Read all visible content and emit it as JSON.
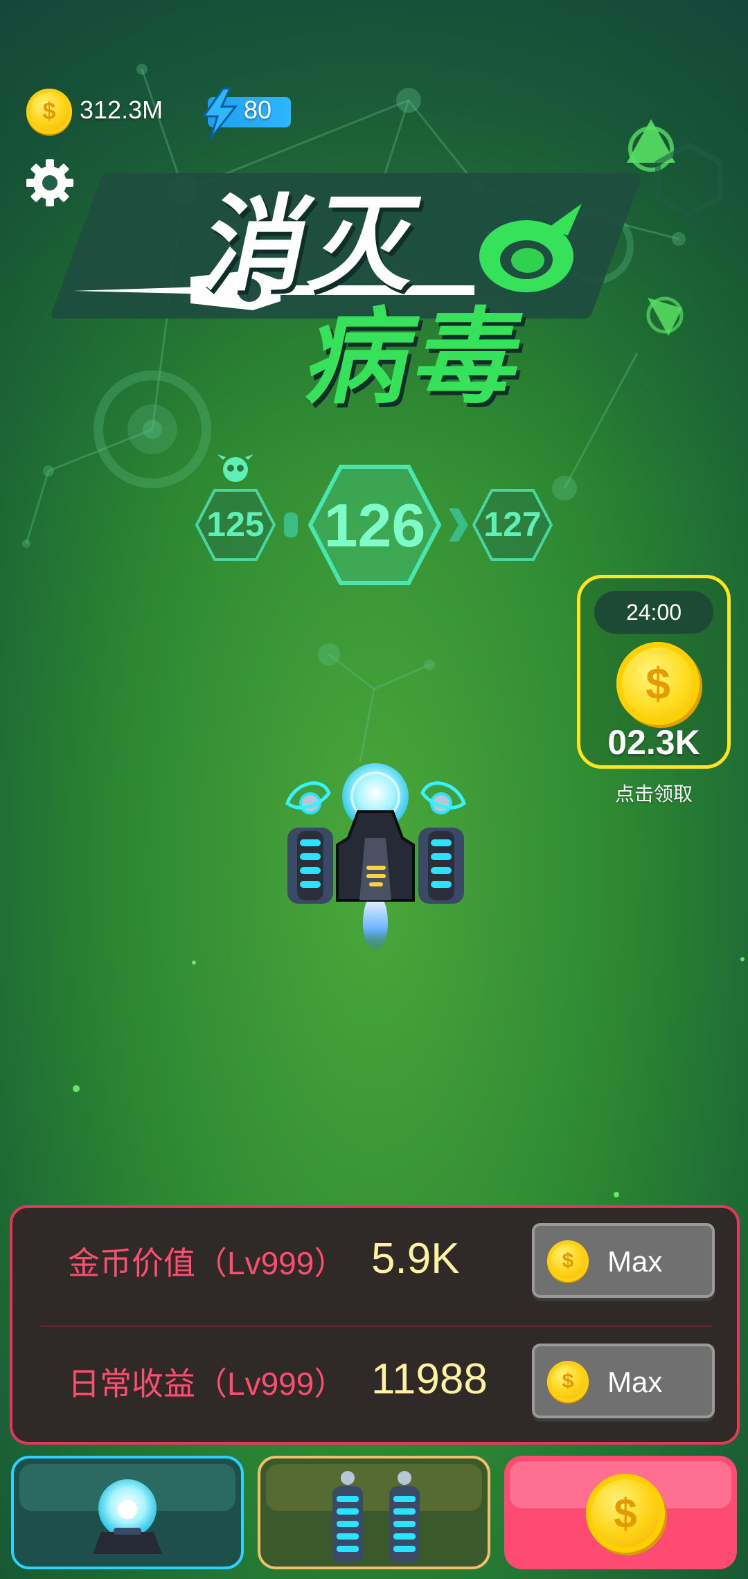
{
  "status": {
    "coins": "312.3M",
    "energy": "80",
    "coin_icon": "coin-icon",
    "energy_icon": "lightning-icon",
    "settings_icon": "gear-icon"
  },
  "title": {
    "line1": "消灭",
    "line2": "病毒"
  },
  "levels": {
    "previous": "125",
    "current": "126",
    "next": "127"
  },
  "bonus": {
    "timer": "24:00",
    "amount": "02.3K",
    "caption": "点击领取"
  },
  "upgrades": [
    {
      "label": "金币价值（Lv999）",
      "value": "5.9K",
      "button": "Max"
    },
    {
      "label": "日常收益（Lv999）",
      "value": "11988",
      "button": "Max"
    }
  ],
  "tabs": [
    {
      "icon": "orb-turret-icon"
    },
    {
      "icon": "twin-cannons-icon"
    },
    {
      "icon": "coin-icon"
    }
  ],
  "colors": {
    "accent_green": "#35e25a",
    "panel_border": "#e8365a",
    "label_pink": "#ff4d70",
    "value_yellow": "#fff2a0",
    "bonus_border": "#ffe51c"
  }
}
